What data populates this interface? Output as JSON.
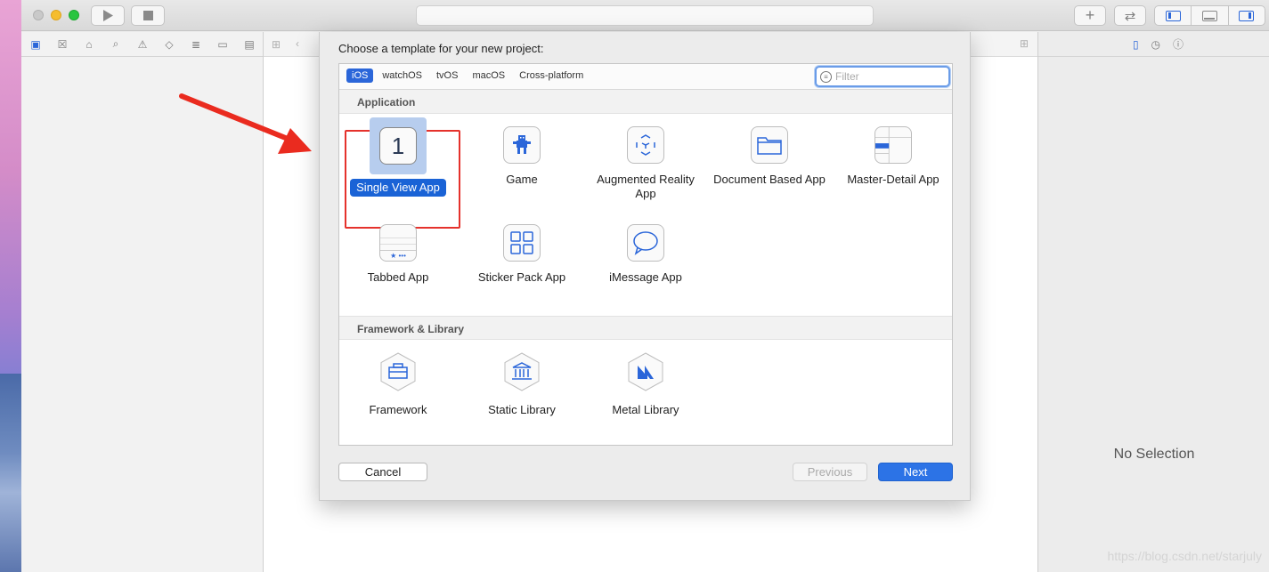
{
  "toolbar": {
    "add_glyph": "+",
    "swap_glyph": "⇄"
  },
  "sheet": {
    "title": "Choose a template for your new project:",
    "tabs": [
      "iOS",
      "watchOS",
      "tvOS",
      "macOS",
      "Cross-platform"
    ],
    "active_tab": "iOS",
    "filter_placeholder": "Filter",
    "sections": [
      {
        "title": "Application",
        "items": [
          {
            "label": "Single View App",
            "icon": "single-view-icon",
            "selected": true,
            "glyph": "1"
          },
          {
            "label": "Game",
            "icon": "game-icon"
          },
          {
            "label": "Augmented Reality App",
            "icon": "ar-cube-icon"
          },
          {
            "label": "Document Based App",
            "icon": "folder-icon"
          },
          {
            "label": "Master-Detail App",
            "icon": "master-detail-icon"
          },
          {
            "label": "Tabbed App",
            "icon": "tab-bar-icon",
            "glyph": "★ •••"
          },
          {
            "label": "Sticker Pack App",
            "icon": "sticker-grid-icon"
          },
          {
            "label": "iMessage App",
            "icon": "message-bubble-icon"
          }
        ]
      },
      {
        "title": "Framework & Library",
        "items": [
          {
            "label": "Framework",
            "icon": "toolbox-icon"
          },
          {
            "label": "Static Library",
            "icon": "building-icon"
          },
          {
            "label": "Metal Library",
            "icon": "metal-icon"
          }
        ]
      }
    ],
    "buttons": {
      "cancel": "Cancel",
      "previous": "Previous",
      "next": "Next"
    }
  },
  "inspector": {
    "empty_text": "No Selection"
  },
  "watermark": "https://blog.csdn.net/starjuly",
  "colors": {
    "accent": "#2b66d9",
    "annotation_red": "#e5322c"
  }
}
